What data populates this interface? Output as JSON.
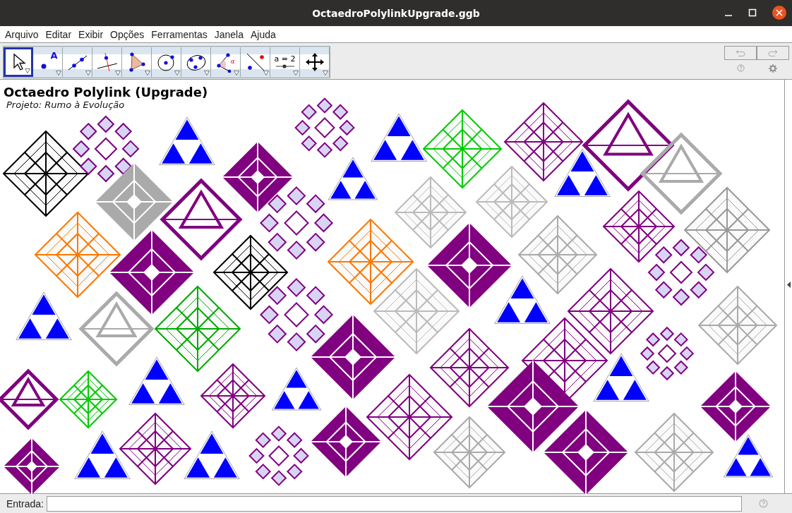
{
  "window": {
    "title": "OctaedroPolylinkUpgrade.ggb"
  },
  "menu": [
    "Arquivo",
    "Editar",
    "Exibir",
    "Opções",
    "Ferramentas",
    "Janela",
    "Ajuda"
  ],
  "tools": [
    {
      "kind": "move",
      "selected": true
    },
    {
      "kind": "point",
      "selected": false,
      "label": "A"
    },
    {
      "kind": "line",
      "selected": false
    },
    {
      "kind": "perpendicular",
      "selected": false
    },
    {
      "kind": "polygon",
      "selected": false
    },
    {
      "kind": "circle",
      "selected": false
    },
    {
      "kind": "conic",
      "selected": false
    },
    {
      "kind": "angle",
      "selected": false,
      "label": "α"
    },
    {
      "kind": "reflect",
      "selected": false
    },
    {
      "kind": "slider",
      "selected": false,
      "label": "a = 2"
    },
    {
      "kind": "pan",
      "selected": false
    }
  ],
  "canvas": {
    "title": "Octaedro Polylink (Upgrade)",
    "subtitle": "Projeto: Rumo à Evolução"
  },
  "input_bar": {
    "label": "Entrada:"
  }
}
